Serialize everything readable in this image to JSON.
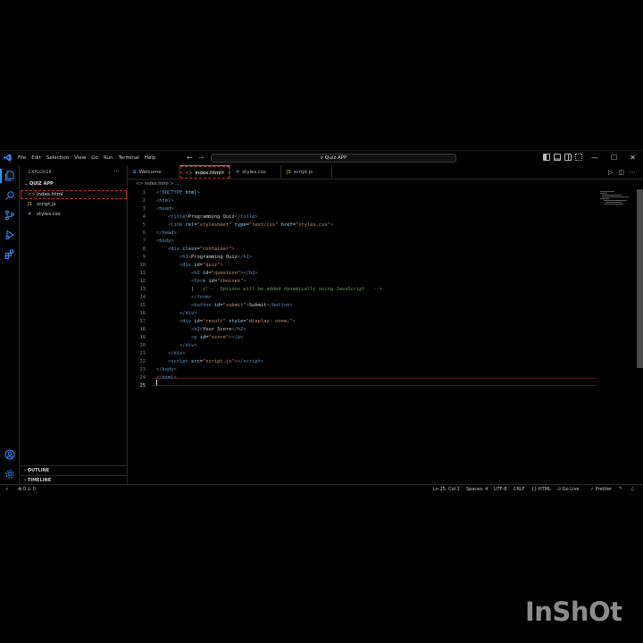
{
  "window": {
    "title": "Quiz APP"
  },
  "menu": [
    "File",
    "Edit",
    "Selection",
    "View",
    "Go",
    "Run",
    "Terminal",
    "Help"
  ],
  "sidebar": {
    "title": "EXPLORER",
    "more": "···",
    "project": "QUIZ APP",
    "files": [
      {
        "name": "index.html",
        "icon": "<>",
        "icon_color": "#e37933",
        "active": true
      },
      {
        "name": "script.js",
        "icon": "JS",
        "icon_color": "#cbcb41",
        "active": false
      },
      {
        "name": "styles.css",
        "icon": "#",
        "icon_color": "#519aba",
        "active": false
      }
    ],
    "outline": "OUTLINE",
    "timeline": "TIMELINE"
  },
  "tabs": [
    {
      "label": "Welcome",
      "icon": "⧉",
      "icon_color": "#3794ff",
      "active": false
    },
    {
      "label": "index.html",
      "icon": "<>",
      "icon_color": "#e37933",
      "active": true,
      "close": "×"
    },
    {
      "label": "styles.css",
      "icon": "#",
      "icon_color": "#519aba",
      "active": false
    },
    {
      "label": "script.js",
      "icon": "JS",
      "icon_color": "#cbcb41",
      "active": false
    }
  ],
  "breadcrumb": "<> index.html > ...",
  "current_line": 25,
  "code": [
    [
      [
        "t",
        "<!DOCTYPE "
      ],
      [
        "a",
        "html"
      ],
      [
        "t",
        ">"
      ]
    ],
    [
      [
        "g",
        "<"
      ],
      [
        "t",
        "html"
      ],
      [
        "g",
        ">"
      ]
    ],
    [
      [
        "g",
        "<"
      ],
      [
        "t",
        "head"
      ],
      [
        "g",
        ">"
      ]
    ],
    [
      [
        "x",
        "    "
      ],
      [
        "g",
        "<"
      ],
      [
        "t",
        "title"
      ],
      [
        "g",
        ">"
      ],
      [
        "x",
        "Programming Quiz"
      ],
      [
        "g",
        "</"
      ],
      [
        "t",
        "title"
      ],
      [
        "g",
        ">"
      ]
    ],
    [
      [
        "x",
        "    "
      ],
      [
        "g",
        "<"
      ],
      [
        "t",
        "link "
      ],
      [
        "a",
        "rel"
      ],
      [
        "x",
        "="
      ],
      [
        "s",
        "\"stylesheet\""
      ],
      [
        "a",
        " type"
      ],
      [
        "x",
        "="
      ],
      [
        "s",
        "\"text/css\""
      ],
      [
        "a",
        " href"
      ],
      [
        "x",
        "="
      ],
      [
        "s",
        "\"styles.css\""
      ],
      [
        "g",
        ">"
      ]
    ],
    [
      [
        "g",
        "</"
      ],
      [
        "t",
        "head"
      ],
      [
        "g",
        ">"
      ]
    ],
    [
      [
        "g",
        "<"
      ],
      [
        "t",
        "body"
      ],
      [
        "g",
        ">"
      ]
    ],
    [
      [
        "x",
        "    "
      ],
      [
        "g",
        "<"
      ],
      [
        "t",
        "div "
      ],
      [
        "a",
        "class"
      ],
      [
        "x",
        "="
      ],
      [
        "s",
        "\"container\""
      ],
      [
        "g",
        ">"
      ]
    ],
    [
      [
        "x",
        "        "
      ],
      [
        "g",
        "<"
      ],
      [
        "t",
        "h1"
      ],
      [
        "g",
        ">"
      ],
      [
        "x",
        "Programming Quiz"
      ],
      [
        "g",
        "</"
      ],
      [
        "t",
        "h1"
      ],
      [
        "g",
        ">"
      ]
    ],
    [
      [
        "x",
        "        "
      ],
      [
        "g",
        "<"
      ],
      [
        "t",
        "div "
      ],
      [
        "a",
        "id"
      ],
      [
        "x",
        "="
      ],
      [
        "s",
        "\"quiz\""
      ],
      [
        "g",
        ">"
      ]
    ],
    [
      [
        "x",
        "            "
      ],
      [
        "g",
        "<"
      ],
      [
        "t",
        "h2 "
      ],
      [
        "a",
        "id"
      ],
      [
        "x",
        "="
      ],
      [
        "s",
        "\"question\""
      ],
      [
        "g",
        "></"
      ],
      [
        "t",
        "h2"
      ],
      [
        "g",
        ">"
      ]
    ],
    [
      [
        "x",
        "            "
      ],
      [
        "g",
        "<"
      ],
      [
        "t",
        "form "
      ],
      [
        "a",
        "id"
      ],
      [
        "x",
        "="
      ],
      [
        "s",
        "\"choices\""
      ],
      [
        "g",
        ">"
      ]
    ],
    [
      [
        "x",
        "            |   "
      ],
      [
        "c",
        "<!--  Options will be added dynamically using JavaScript   -->"
      ]
    ],
    [
      [
        "x",
        "            "
      ],
      [
        "g",
        "</"
      ],
      [
        "t",
        "form"
      ],
      [
        "g",
        ">"
      ]
    ],
    [
      [
        "x",
        "            "
      ],
      [
        "g",
        "<"
      ],
      [
        "t",
        "button "
      ],
      [
        "a",
        "id"
      ],
      [
        "x",
        "="
      ],
      [
        "s",
        "\"submit\""
      ],
      [
        "g",
        ">"
      ],
      [
        "x",
        "Submit"
      ],
      [
        "g",
        "</"
      ],
      [
        "t",
        "button"
      ],
      [
        "g",
        ">"
      ]
    ],
    [
      [
        "x",
        "        "
      ],
      [
        "g",
        "</"
      ],
      [
        "t",
        "div"
      ],
      [
        "g",
        ">"
      ]
    ],
    [
      [
        "x",
        "        "
      ],
      [
        "g",
        "<"
      ],
      [
        "t",
        "div "
      ],
      [
        "a",
        "id"
      ],
      [
        "x",
        "="
      ],
      [
        "s",
        "\"result\""
      ],
      [
        "a",
        " style"
      ],
      [
        "x",
        "="
      ],
      [
        "s",
        "\"display: none;\""
      ],
      [
        "g",
        ">"
      ]
    ],
    [
      [
        "x",
        "            "
      ],
      [
        "g",
        "<"
      ],
      [
        "t",
        "h2"
      ],
      [
        "g",
        ">"
      ],
      [
        "x",
        "Your Score"
      ],
      [
        "g",
        "</"
      ],
      [
        "t",
        "h2"
      ],
      [
        "g",
        ">"
      ]
    ],
    [
      [
        "x",
        "            "
      ],
      [
        "g",
        "<"
      ],
      [
        "t",
        "p "
      ],
      [
        "a",
        "id"
      ],
      [
        "x",
        "="
      ],
      [
        "s",
        "\"score\""
      ],
      [
        "g",
        "></"
      ],
      [
        "t",
        "p"
      ],
      [
        "g",
        ">"
      ]
    ],
    [
      [
        "x",
        "        "
      ],
      [
        "g",
        "</"
      ],
      [
        "t",
        "div"
      ],
      [
        "g",
        ">"
      ]
    ],
    [
      [
        "x",
        "    "
      ],
      [
        "g",
        "</"
      ],
      [
        "t",
        "div"
      ],
      [
        "g",
        ">"
      ]
    ],
    [
      [
        "x",
        "    "
      ],
      [
        "g",
        "<"
      ],
      [
        "t",
        "script "
      ],
      [
        "a",
        "src"
      ],
      [
        "x",
        "="
      ],
      [
        "s",
        "\"script.js\""
      ],
      [
        "g",
        "></"
      ],
      [
        "t",
        "script"
      ],
      [
        "g",
        ">"
      ]
    ],
    [
      [
        "g",
        "</"
      ],
      [
        "t",
        "body"
      ],
      [
        "g",
        ">"
      ]
    ],
    [
      [
        "g",
        "</"
      ],
      [
        "t",
        "html"
      ],
      [
        "g",
        ">"
      ]
    ],
    []
  ],
  "statusbar": {
    "remote": "⚡",
    "problems": "⊗ 0 ⚠ 0",
    "position": "Ln 25, Col 1",
    "spaces": "Spaces: 4",
    "encoding": "UTF-8",
    "eol": "CRLF",
    "language": "{} HTML",
    "golive": "⊙ Go Live",
    "prettier": "✓ Prettier",
    "bell": "🔔"
  },
  "watermark": "InShOt"
}
